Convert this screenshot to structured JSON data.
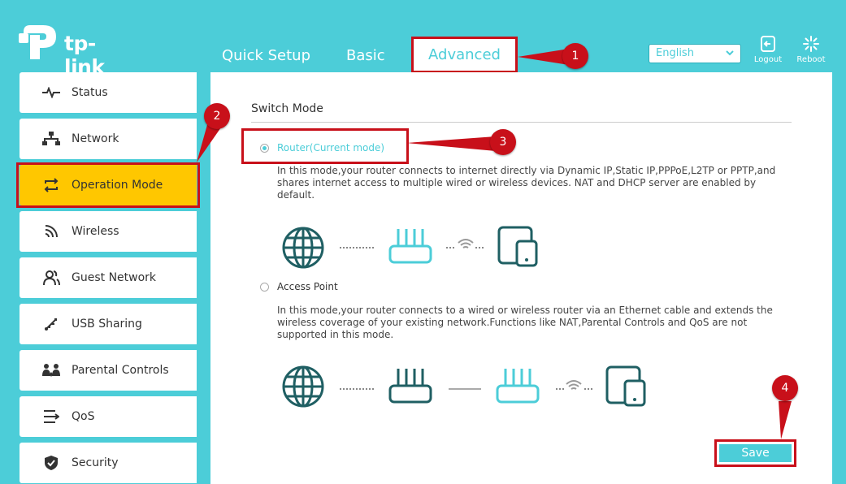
{
  "header": {
    "brand": "tp-link",
    "tabs": [
      {
        "label": "Quick Setup"
      },
      {
        "label": "Basic"
      },
      {
        "label": "Advanced"
      }
    ],
    "language": "English",
    "logout_label": "Logout",
    "reboot_label": "Reboot"
  },
  "sidebar": {
    "items": [
      {
        "label": "Status",
        "icon": "pulse-icon"
      },
      {
        "label": "Network",
        "icon": "network-icon"
      },
      {
        "label": "Operation Mode",
        "icon": "switch-arrows-icon"
      },
      {
        "label": "Wireless",
        "icon": "wifi-icon"
      },
      {
        "label": "Guest Network",
        "icon": "users-icon"
      },
      {
        "label": "USB Sharing",
        "icon": "usb-icon"
      },
      {
        "label": "Parental Controls",
        "icon": "family-icon"
      },
      {
        "label": "QoS",
        "icon": "qos-icon"
      },
      {
        "label": "Security",
        "icon": "shield-icon"
      }
    ],
    "active": "Operation Mode"
  },
  "main": {
    "section_title": "Switch Mode",
    "router_option": {
      "label": "Router(Current mode)",
      "selected": true,
      "description": "In this mode,your router connects to internet directly via Dynamic IP,Static IP,PPPoE,L2TP or PPTP,and shares internet access to multiple wired or wireless devices. NAT and DHCP server are enabled by default."
    },
    "ap_option": {
      "label": "Access Point",
      "selected": false,
      "description": "In this mode,your router connects to a wired or wireless router via an Ethernet cable and extends the wireless coverage of your existing network.Functions like NAT,Parental Controls and QoS are not supported in this mode."
    },
    "save_label": "Save"
  },
  "callouts": [
    "1",
    "2",
    "3",
    "4"
  ],
  "colors": {
    "accent": "#4ccdd8",
    "active": "#ffc700",
    "highlight": "#c8101a",
    "icon_dark": "#1f5f63"
  }
}
